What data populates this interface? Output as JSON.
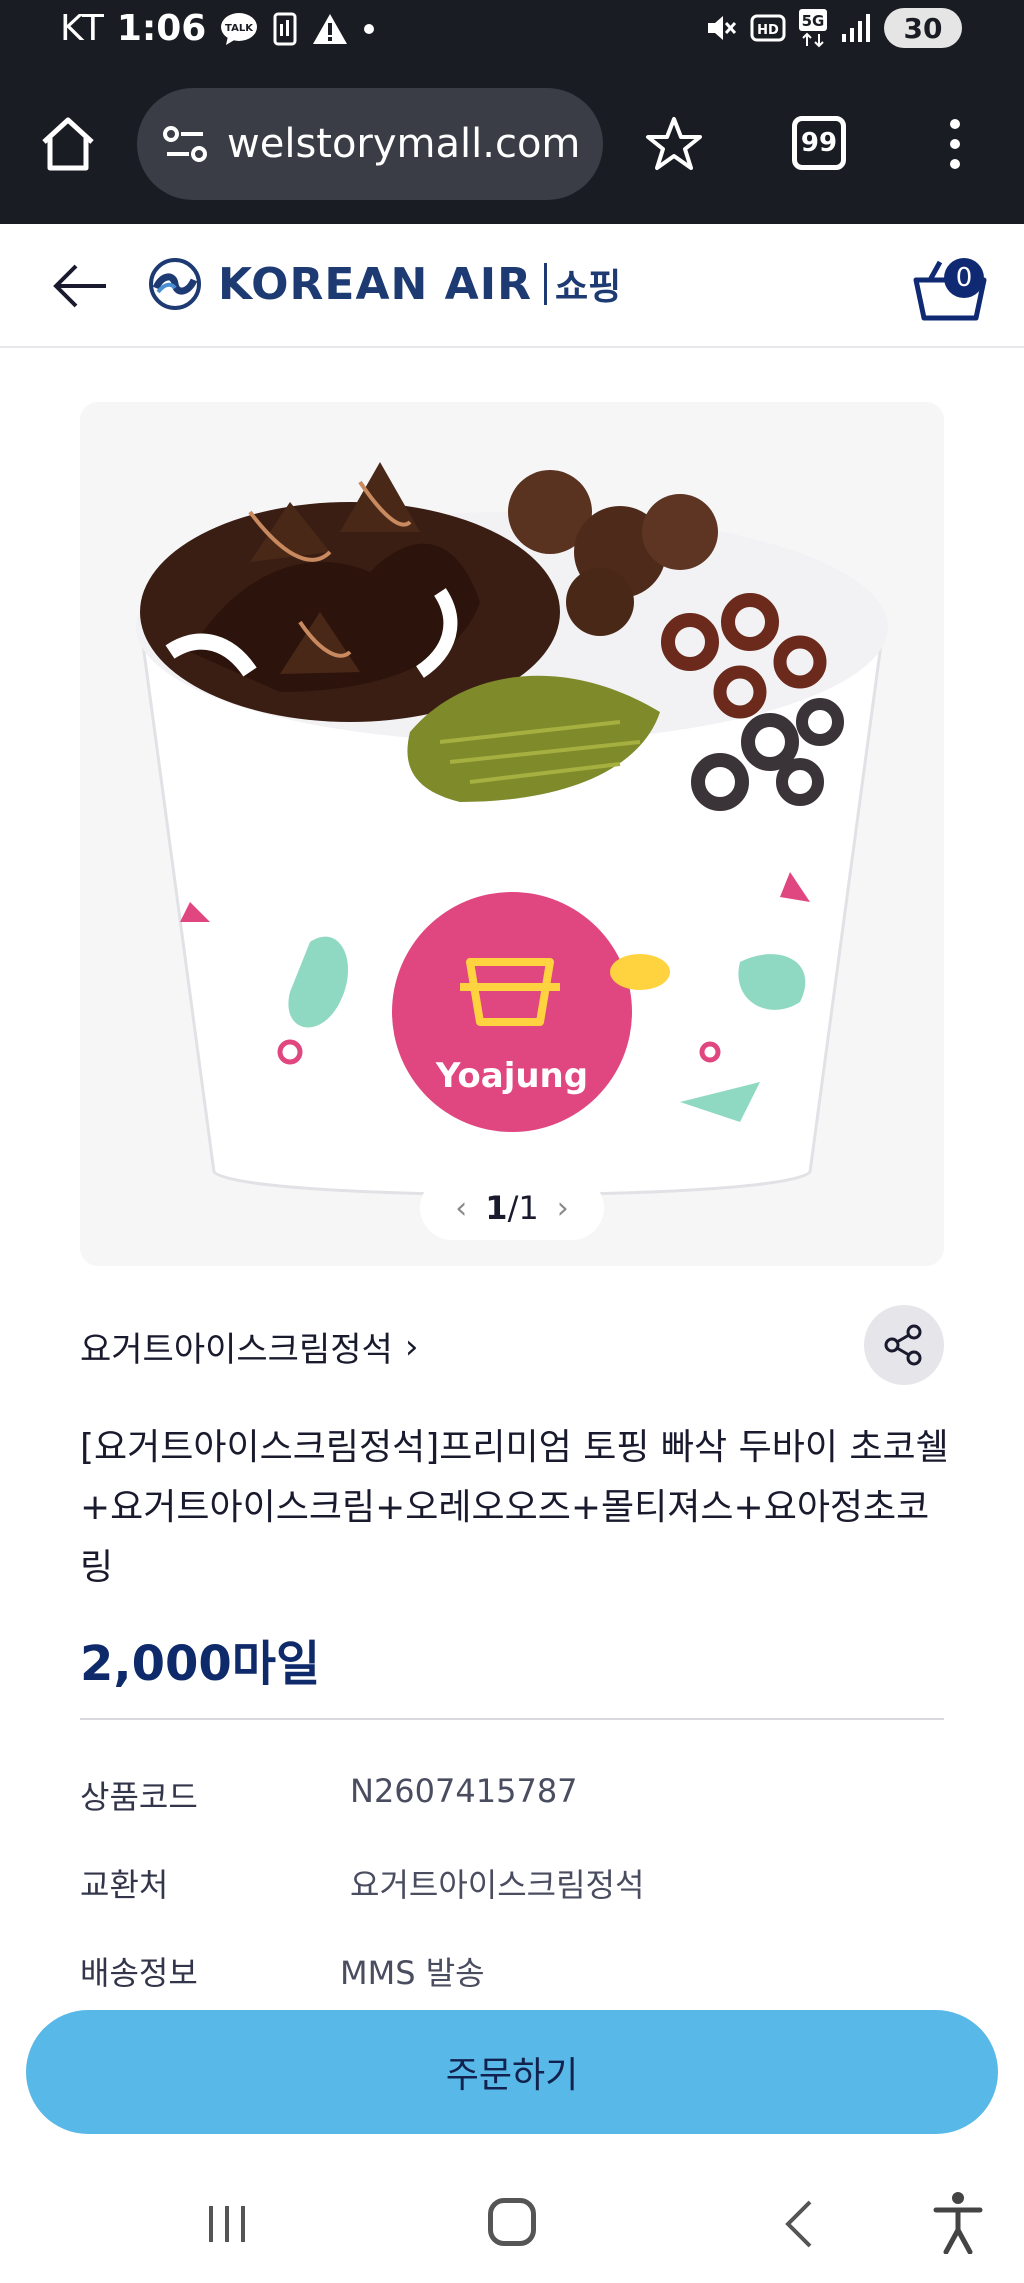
{
  "status_bar": {
    "carrier": "KT",
    "time": "1:06",
    "battery": "30",
    "notification_icons": [
      "talk-icon",
      "sim-icon",
      "warning-icon",
      "dot-icon"
    ],
    "system_icons": [
      "mute-icon",
      "hd-icon",
      "5g-icon",
      "signal-icon"
    ]
  },
  "browser": {
    "url": "welstorymall.com",
    "tab_count": "99"
  },
  "header": {
    "brand": "KOREAN AIR",
    "section": "쇼핑",
    "cart_count": "0"
  },
  "product": {
    "image_brand": "Yoajung",
    "image_pager": {
      "current": "1",
      "separator": "/",
      "total": "1",
      "prev": "‹",
      "next": "›"
    },
    "category": "요거트아이스크림정석",
    "category_arrow": "›",
    "title": "[요거트아이스크림정석]프리미엄 토핑 빠삭 두바이 초코쉘+요거트아이스크림+오레오오즈+몰티져스+요아정초코링",
    "price": "2,000마일",
    "info": [
      {
        "key": "상품코드",
        "value": "N2607415787"
      },
      {
        "key": "교환처",
        "value": "요거트아이스크림정석"
      },
      {
        "key": "배송정보",
        "value": "MMS 발송"
      }
    ]
  },
  "order_button": "주문하기",
  "colors": {
    "accent": "#58b8e8",
    "brand_navy": "#0f2a6b",
    "status_bg": "#191c22"
  }
}
